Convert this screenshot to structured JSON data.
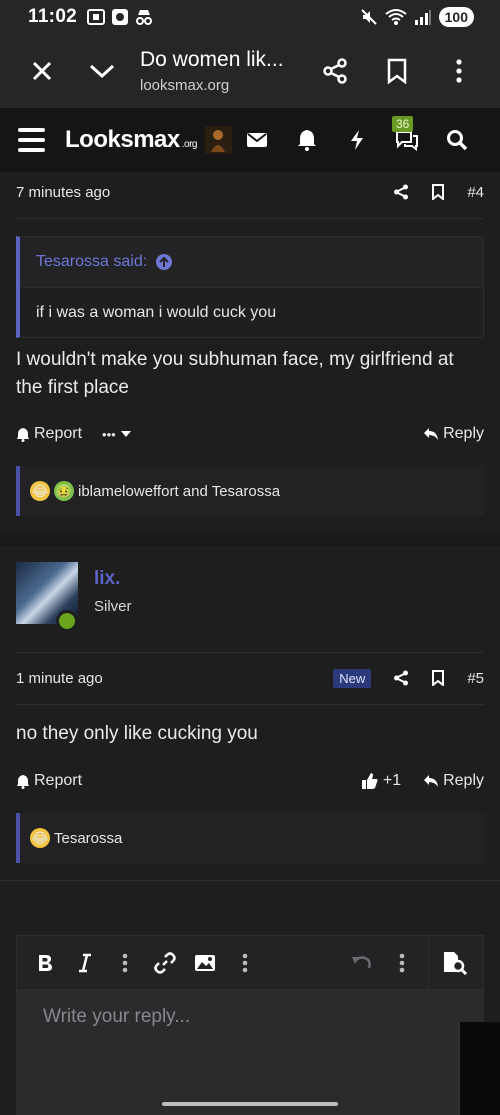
{
  "status": {
    "time": "11:02",
    "battery": "100"
  },
  "browser": {
    "title": "Do women lik...",
    "url": "looksmax.org"
  },
  "site": {
    "logo": "Looksmax",
    "logo_suffix": ".org",
    "chat_badge": "36"
  },
  "post4": {
    "time": "7 minutes ago",
    "number": "#4",
    "quote_author": "Tesarossa said:",
    "quote_text": "if i was a woman i would cuck you",
    "text": "I wouldn't make you subhuman face, my girlfriend at the first place",
    "report": "Report",
    "reply": "Reply",
    "more": "•••",
    "reactions_text": "iblameloweffort and Tesarossa"
  },
  "user": {
    "name": "lix.",
    "title": "Silver"
  },
  "post5": {
    "time": "1 minute ago",
    "new_badge": "New",
    "number": "#5",
    "text": "no they only like cucking you",
    "report": "Report",
    "like_count": "+1",
    "reply": "Reply",
    "reactions_text": "Tesarossa"
  },
  "editor": {
    "placeholder": "Write your reply..."
  }
}
